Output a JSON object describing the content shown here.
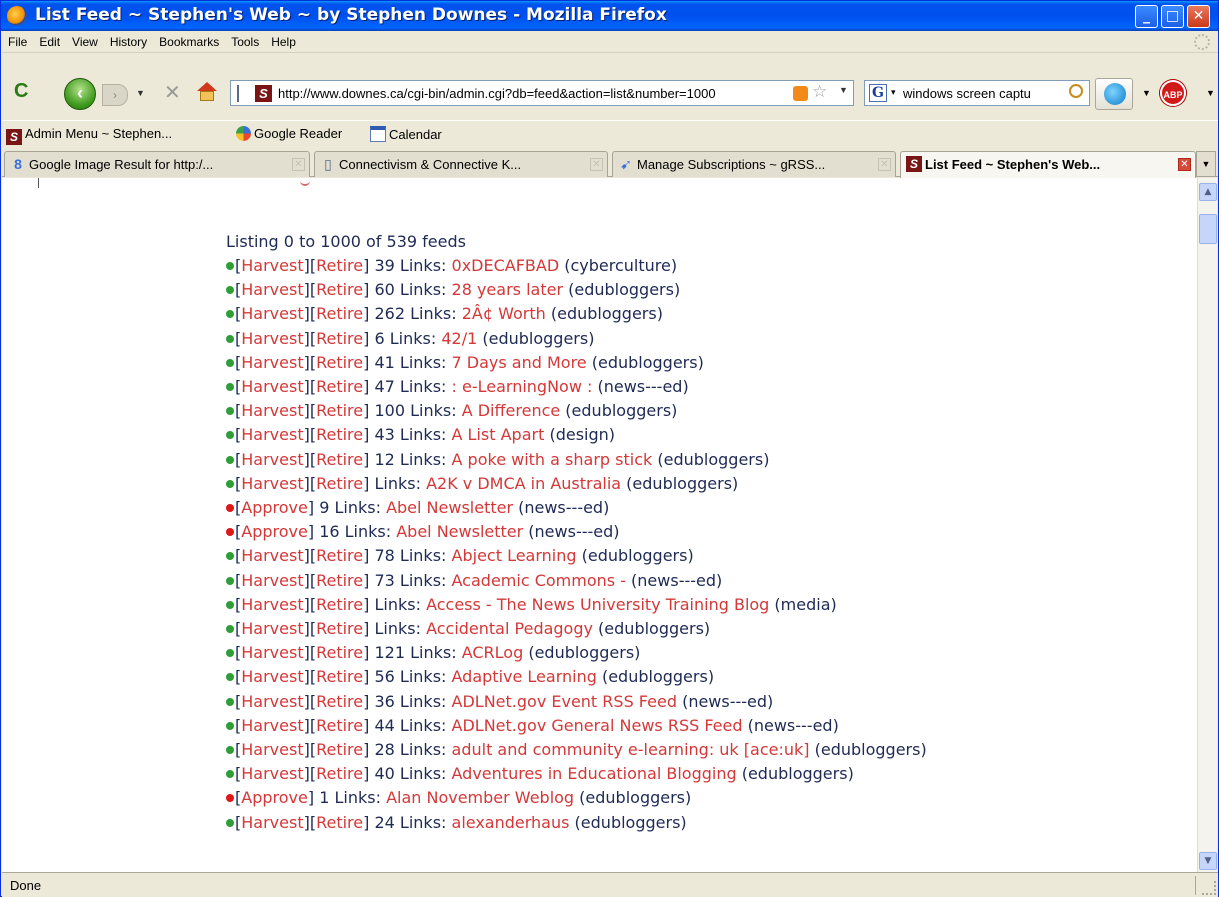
{
  "window": {
    "title": "List Feed ~ Stephen's Web ~ by Stephen Downes - Mozilla Firefox",
    "controls": {
      "minimize": "_",
      "maximize": "□",
      "close": "✕"
    }
  },
  "menu": [
    "File",
    "Edit",
    "View",
    "History",
    "Bookmarks",
    "Tools",
    "Help"
  ],
  "toolbar": {
    "url": "http://www.downes.ca/cgi-bin/admin.cgi?db=feed&action=list&number=1000",
    "search_value": "windows screen captu",
    "search_engine_letter": "G",
    "adblock_label": "ABP"
  },
  "bookmarks": [
    {
      "label": "Admin Menu ~ Stephen...",
      "icon": "stephens-web-icon"
    },
    {
      "label": "Google Reader",
      "icon": "google-reader-icon"
    },
    {
      "label": "Calendar",
      "icon": "calendar-icon"
    }
  ],
  "tabs": [
    {
      "label": "Google Image Result for http:/...",
      "icon": "google-icon",
      "active": false
    },
    {
      "label": "Connectivism & Connective K...",
      "icon": "page-icon",
      "active": false
    },
    {
      "label": "Manage Subscriptions ~ gRSS...",
      "icon": "grss-icon",
      "active": false
    },
    {
      "label": "List Feed ~ Stephen's Web...",
      "icon": "stephens-web-icon",
      "active": true
    }
  ],
  "content": {
    "heading": "Listing 0 to 1000 of 539 feeds",
    "feeds": [
      {
        "status": "green",
        "actions": [
          "Harvest",
          "Retire"
        ],
        "count": "39",
        "title": "0xDECAFBAD",
        "category": "cyberculture"
      },
      {
        "status": "green",
        "actions": [
          "Harvest",
          "Retire"
        ],
        "count": "60",
        "title": "28 years later",
        "category": "edubloggers"
      },
      {
        "status": "green",
        "actions": [
          "Harvest",
          "Retire"
        ],
        "count": "262",
        "title": "2Â¢ Worth",
        "category": "edubloggers"
      },
      {
        "status": "green",
        "actions": [
          "Harvest",
          "Retire"
        ],
        "count": "6",
        "title": "42/1",
        "category": "edubloggers"
      },
      {
        "status": "green",
        "actions": [
          "Harvest",
          "Retire"
        ],
        "count": "41",
        "title": "7 Days and More",
        "category": "edubloggers"
      },
      {
        "status": "green",
        "actions": [
          "Harvest",
          "Retire"
        ],
        "count": "47",
        "title": ": e-LearningNow :",
        "category": "news---ed"
      },
      {
        "status": "green",
        "actions": [
          "Harvest",
          "Retire"
        ],
        "count": "100",
        "title": "A Difference",
        "category": "edubloggers"
      },
      {
        "status": "green",
        "actions": [
          "Harvest",
          "Retire"
        ],
        "count": "43",
        "title": "A List Apart",
        "category": "design"
      },
      {
        "status": "green",
        "actions": [
          "Harvest",
          "Retire"
        ],
        "count": "12",
        "title": "A poke with a sharp stick",
        "category": "edubloggers"
      },
      {
        "status": "green",
        "actions": [
          "Harvest",
          "Retire"
        ],
        "count": "",
        "title": "A2K v DMCA in Australia",
        "category": "edubloggers"
      },
      {
        "status": "red",
        "actions": [
          "Approve"
        ],
        "count": "9",
        "title": "Abel Newsletter",
        "category": "news---ed"
      },
      {
        "status": "red",
        "actions": [
          "Approve"
        ],
        "count": "16",
        "title": "Abel Newsletter",
        "category": "news---ed"
      },
      {
        "status": "green",
        "actions": [
          "Harvest",
          "Retire"
        ],
        "count": "78",
        "title": "Abject Learning",
        "category": "edubloggers"
      },
      {
        "status": "green",
        "actions": [
          "Harvest",
          "Retire"
        ],
        "count": "73",
        "title": "Academic Commons -",
        "category": "news---ed"
      },
      {
        "status": "green",
        "actions": [
          "Harvest",
          "Retire"
        ],
        "count": "",
        "title": "Access - The News University Training Blog",
        "category": "media"
      },
      {
        "status": "green",
        "actions": [
          "Harvest",
          "Retire"
        ],
        "count": "",
        "title": "Accidental Pedagogy",
        "category": "edubloggers"
      },
      {
        "status": "green",
        "actions": [
          "Harvest",
          "Retire"
        ],
        "count": "121",
        "title": "ACRLog",
        "category": "edubloggers"
      },
      {
        "status": "green",
        "actions": [
          "Harvest",
          "Retire"
        ],
        "count": "56",
        "title": "Adaptive Learning",
        "category": "edubloggers"
      },
      {
        "status": "green",
        "actions": [
          "Harvest",
          "Retire"
        ],
        "count": "36",
        "title": "ADLNet.gov Event RSS Feed",
        "category": "news---ed"
      },
      {
        "status": "green",
        "actions": [
          "Harvest",
          "Retire"
        ],
        "count": "44",
        "title": "ADLNet.gov General News RSS Feed",
        "category": "news---ed"
      },
      {
        "status": "green",
        "actions": [
          "Harvest",
          "Retire"
        ],
        "count": "28",
        "title": "adult and community e-learning: uk [ace:uk]",
        "category": "edubloggers"
      },
      {
        "status": "green",
        "actions": [
          "Harvest",
          "Retire"
        ],
        "count": "40",
        "title": "Adventures in Educational Blogging",
        "category": "edubloggers"
      },
      {
        "status": "red",
        "actions": [
          "Approve"
        ],
        "count": "1",
        "title": "Alan November Weblog",
        "category": "edubloggers"
      },
      {
        "status": "green",
        "actions": [
          "Harvest",
          "Retire"
        ],
        "count": "24",
        "title": "alexanderhaus",
        "category": "edubloggers"
      }
    ],
    "links_label": "Links:"
  },
  "status": {
    "text": "Done"
  },
  "colors": {
    "titlebar": "#0053ee",
    "link": "#d43838",
    "text": "#1f2a55",
    "dot_green": "#2f9e36",
    "dot_red": "#e01818"
  }
}
